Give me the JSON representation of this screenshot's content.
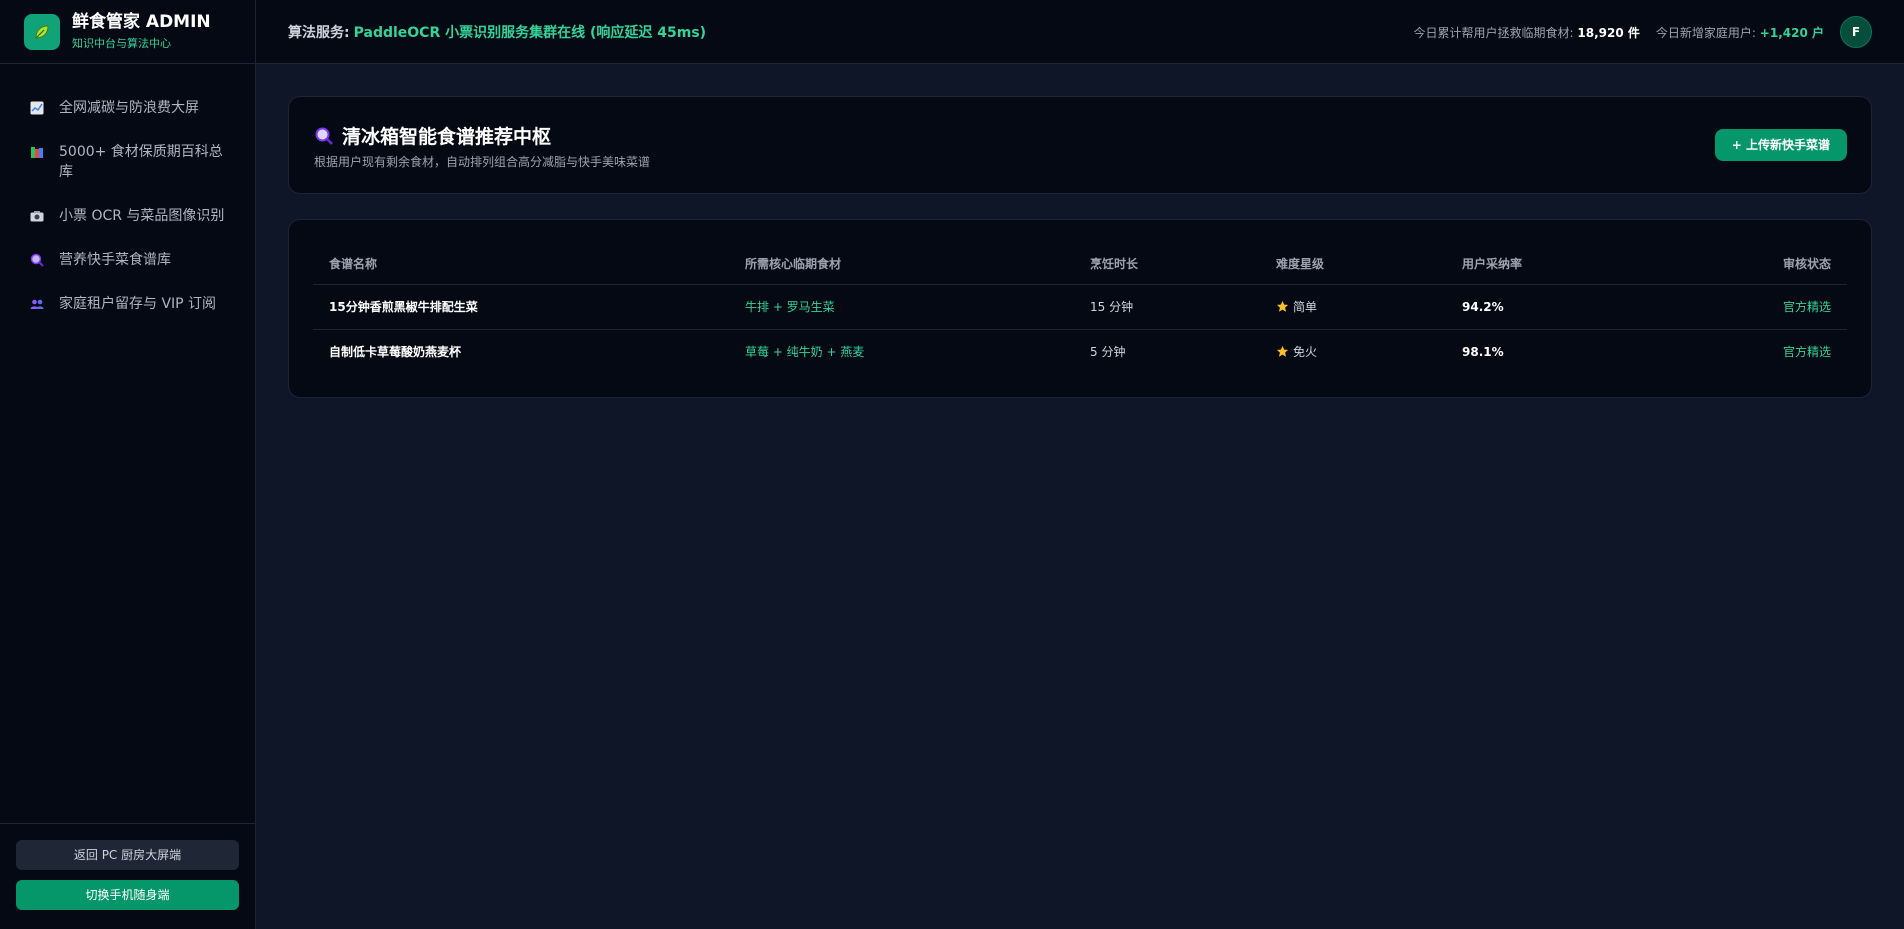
{
  "brand": {
    "title": "鲜食管家 ADMIN",
    "subtitle": "知识中台与算法中心",
    "logo_icon": "leaf-icon"
  },
  "sidebar": {
    "items": [
      {
        "label": "全网减碳与防浪费大屏",
        "icon": "chart-icon"
      },
      {
        "label": "5000+ 食材保质期百科总库",
        "icon": "books-icon"
      },
      {
        "label": "小票 OCR 与菜品图像识别",
        "icon": "camera-icon"
      },
      {
        "label": "营养快手菜食谱库",
        "icon": "magnifier-icon"
      },
      {
        "label": "家庭租户留存与 VIP 订阅",
        "icon": "users-icon"
      }
    ],
    "buttons": {
      "back_pc": "返回 PC 厨房大屏端",
      "switch_mobile": "切换手机随身端"
    }
  },
  "topbar": {
    "service_label": "算法服务:",
    "service_status": "PaddleOCR 小票识别服务集群在线 (响应延迟 45ms)",
    "stat1_label": "今日累计帮用户拯救临期食材:",
    "stat1_value": "18,920 件",
    "stat2_label": "今日新增家庭用户:",
    "stat2_value": "+1,420 户",
    "avatar": "F"
  },
  "main": {
    "title": "清冰箱智能食谱推荐中枢",
    "subtitle": "根据用户现有剩余食材，自动排列组合高分减脂与快手美味菜谱",
    "upload_button": "+ 上传新快手菜谱",
    "table": {
      "headers": [
        "食谱名称",
        "所需核心临期食材",
        "烹饪时长",
        "难度星级",
        "用户采纳率",
        "审核状态"
      ],
      "rows": [
        {
          "name": "15分钟香煎黑椒牛排配生菜",
          "ingredients": "牛排 + 罗马生菜",
          "time": "15 分钟",
          "difficulty": "简单",
          "rate": "94.2%",
          "status": "官方精选"
        },
        {
          "name": "自制低卡草莓酸奶燕麦杯",
          "ingredients": "草莓 + 纯牛奶 + 燕麦",
          "time": "5 分钟",
          "difficulty": "免火",
          "rate": "98.1%",
          "status": "官方精选"
        }
      ]
    }
  },
  "colors": {
    "accent": "#10b981",
    "accent_dark": "#059669",
    "bg": "#0f1627",
    "panel": "#050914",
    "border": "#1c2436"
  }
}
